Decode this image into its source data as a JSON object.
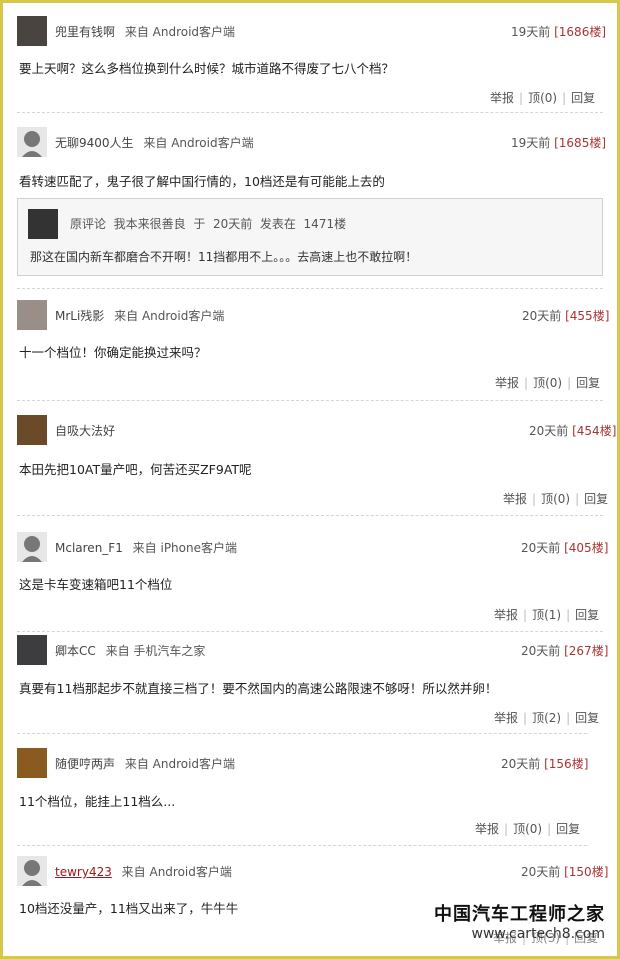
{
  "comments": [
    {
      "user": "兜里有钱啊",
      "source": "来自 Android客户端",
      "time": "19天前",
      "floor": "[1686楼]",
      "text": "要上天啊？这么多档位换到什么时候？城市道路不得废了七八个档？",
      "report": "举报",
      "up": "顶(0)",
      "reply": "回复",
      "avatar": "photo"
    },
    {
      "user": "无聊9400人生",
      "source": "来自 Android客户端",
      "time": "19天前",
      "floor": "[1685楼]",
      "text": "看转速匹配了，鬼子很了解中国行情的，10档还是有可能能上去的",
      "avatar": "default",
      "quote": {
        "label": "原评论",
        "user": "我本来很善良",
        "at": "于",
        "time": "20天前",
        "posted": "发表在",
        "floor": "1471楼",
        "text": "那这在国内新车都磨合不开啊！11挡都用不上。。。去高速上也不敢拉啊！"
      }
    },
    {
      "user": "MrLi残影",
      "source": "来自 Android客户端",
      "time": "20天前",
      "floor": "[455楼]",
      "text": "十一个档位！你确定能换过来吗？",
      "report": "举报",
      "up": "顶(0)",
      "reply": "回复",
      "avatar": "photo"
    },
    {
      "user": "自吸大法好",
      "source": "",
      "time": "20天前",
      "floor": "[454楼]",
      "text": "本田先把10AT量产吧，何苦还买ZF9AT呢",
      "report": "举报",
      "up": "顶(0)",
      "reply": "回复",
      "avatar": "photo"
    },
    {
      "user": "Mclaren_F1",
      "source": "来自 iPhone客户端",
      "time": "20天前",
      "floor": "[405楼]",
      "text": "这是卡车变速箱吧11个档位",
      "report": "举报",
      "up": "顶(1)",
      "reply": "回复",
      "avatar": "default"
    },
    {
      "user": "卿本CC",
      "source": "来自 手机汽车之家",
      "time": "20天前",
      "floor": "[267楼]",
      "text": "真要有11档那起步不就直接三档了！要不然国内的高速公路限速不够呀！所以然并卵！",
      "report": "举报",
      "up": "顶(2)",
      "reply": "回复",
      "avatar": "photo"
    },
    {
      "user": "随便哼两声",
      "source": "来自 Android客户端",
      "time": "20天前",
      "floor": "[156楼]",
      "text": "11个档位，能挂上11档么...",
      "report": "举报",
      "up": "顶(0)",
      "reply": "回复",
      "avatar": "photo"
    },
    {
      "user": "tewry423",
      "source": "来自 Android客户端",
      "time": "20天前",
      "floor": "[150楼]",
      "text": "10档还没量产，11档又出来了，牛牛牛",
      "report": "举报",
      "up": "顶(3)",
      "reply": "回复",
      "avatar": "default"
    }
  ],
  "watermark": {
    "title": "中国汽车工程师之家",
    "url": "www.cartech8.com"
  }
}
